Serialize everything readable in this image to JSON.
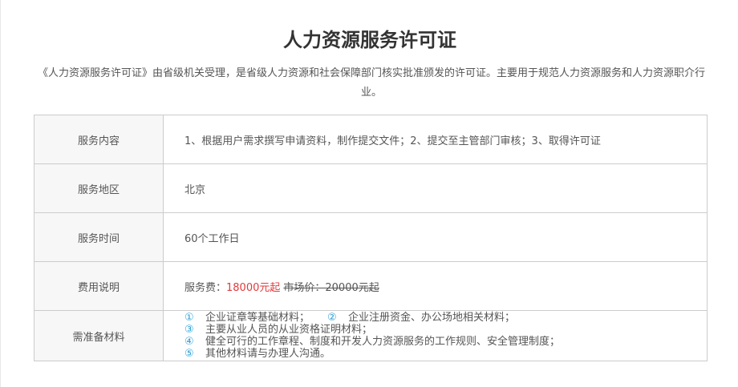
{
  "page": {
    "title": "人力资源服务许可证",
    "description": "《人力资源服务许可证》由省级机关受理，是省级人力资源和社会保障部门核实批准颁发的许可证。主要用于规范人力资源服务和人力资源职介行业。"
  },
  "table": {
    "rows": [
      {
        "label": "服务内容",
        "value": "1、根据用户需求撰写申请资料，制作提交文件；2、提交至主管部门审核；3、取得许可证"
      },
      {
        "label": "服务地区",
        "value": "北京"
      },
      {
        "label": "服务时间",
        "value": "60个工作日"
      }
    ],
    "fee": {
      "label": "费用说明",
      "price_label": "服务费：",
      "price_current": "18000元起",
      "price_market": "市场价：20000元起"
    },
    "materials": {
      "label": "需准备材料",
      "items": [
        {
          "num": "①",
          "text": "企业证章等基础材料；"
        },
        {
          "num": "②",
          "text": "企业注册资金、办公场地相关材料；"
        },
        {
          "num": "③",
          "text": "主要从业人员的从业资格证明材料；"
        },
        {
          "num": "④",
          "text": "健全可行的工作章程、制度和开发人力资源服务的工作规则、安全管理制度；"
        },
        {
          "num": "⑤",
          "text": "其他材料请与办理人沟通。"
        }
      ]
    }
  },
  "colors": {
    "accent_price": "#e4393c",
    "accent_number": "#2a9fd6",
    "label_bg": "#f7f7f7",
    "border": "#cccccc"
  }
}
